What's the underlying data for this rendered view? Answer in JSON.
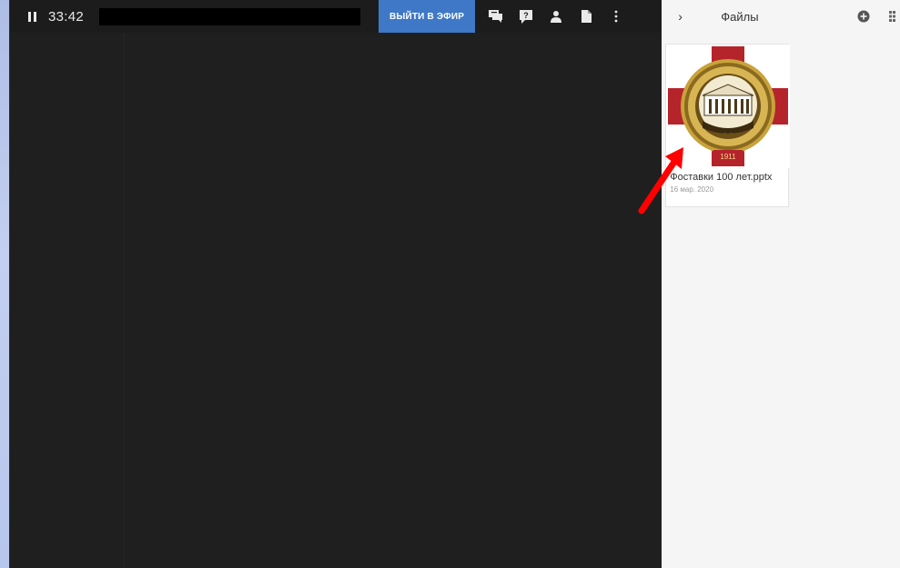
{
  "player": {
    "timer": "33:42",
    "title_value": "",
    "go_live_label": "ВЫЙТИ В ЭФИР"
  },
  "toolbar_icons": [
    "chat-icon",
    "question-icon",
    "participants-icon",
    "file-icon",
    "more-vert-icon"
  ],
  "files_panel": {
    "collapse_glyph": "›",
    "title": "Файлы",
    "files": [
      {
        "name": "Фоставки 100 лет.pptx",
        "date": "16 мар. 2020",
        "thumbnail_badge": "1911"
      }
    ]
  },
  "colors": {
    "player_bg": "#1f1f1f",
    "accent_button": "#3f78c6",
    "panel_bg": "#f5f5f5",
    "annotation_arrow": "#ff0000"
  }
}
